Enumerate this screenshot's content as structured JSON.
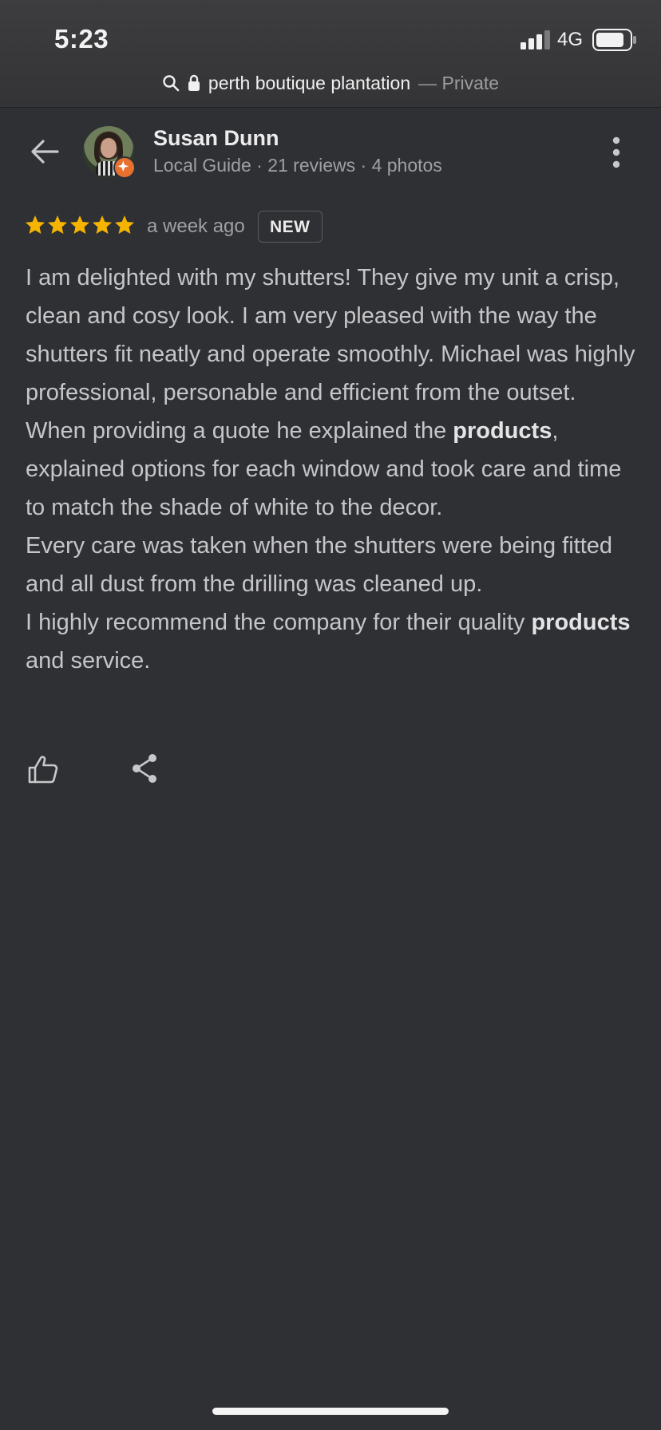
{
  "status_bar": {
    "time": "5:23",
    "network": "4G",
    "icons": [
      "signal-icon",
      "battery-icon"
    ]
  },
  "browser": {
    "url_text": "perth boutique plantation",
    "private_label": "— Private",
    "icons": [
      "search-icon",
      "lock-icon"
    ]
  },
  "header": {
    "name": "Susan Dunn",
    "meta": "Local Guide · 21 reviews · 4 photos",
    "icons": [
      "back-arrow-icon",
      "more-vert-icon",
      "local-guide-badge-icon"
    ]
  },
  "review": {
    "rating": 5,
    "rating_max": 5,
    "time_ago": "a week ago",
    "badge": "NEW",
    "paragraphs": [
      [
        {
          "text": "I am delighted with my shutters! They give my unit a crisp, clean and cosy look. I am very pleased with the way the shutters fit neatly and operate smoothly. Michael was highly professional, personable and efficient from the outset. When providing a quote he explained the ",
          "bold": false
        },
        {
          "text": "products",
          "bold": true
        },
        {
          "text": ", explained options for each window and took care and time to match the shade of white to the decor.",
          "bold": false
        }
      ],
      [
        {
          "text": "Every care was taken when the shutters were being fitted and all dust from the drilling was cleaned up.",
          "bold": false
        }
      ],
      [
        {
          "text": "I highly recommend the company for their quality ",
          "bold": false
        },
        {
          "text": "products",
          "bold": true
        },
        {
          "text": " and service.",
          "bold": false
        }
      ]
    ]
  },
  "actions": {
    "icons": [
      "thumbs-up-icon",
      "share-icon"
    ]
  },
  "colors": {
    "background": "#2f3033",
    "star": "#f4b400",
    "guide_badge": "#e8712f",
    "text": "#c6c6c9"
  }
}
